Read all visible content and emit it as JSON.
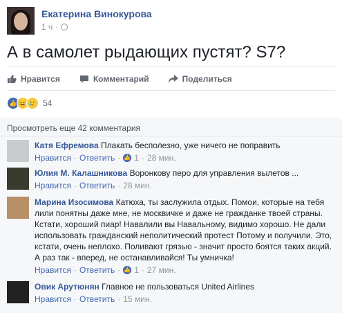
{
  "post": {
    "author": "Екатерина Винокурова",
    "time": "1 ч",
    "text": "А в самолет рыдающих пустят? S7?"
  },
  "actions": {
    "like": "Нравится",
    "comment": "Комментарий",
    "share": "Поделиться"
  },
  "reactions": {
    "count": "54"
  },
  "comments_section": {
    "more_label": "Просмотреть еще 42 комментария",
    "items": [
      {
        "name": "Катя Ефремова",
        "text": "Плакать бесполезно, уже ничего не поправить",
        "like": "Нравится",
        "reply": "Ответить",
        "likes": "1",
        "time": "28 мин."
      },
      {
        "name": "Юлия М. Калашникова",
        "text": "Воронкову перо для управления вылетов ...",
        "like": "Нравится",
        "reply": "Ответить",
        "time": "28 мин."
      },
      {
        "name": "Марина Изосимова",
        "text": "Катюха, ты заслужила отдых. Помои, которые на тебя лили понятны даже мне, не москвичке и даже не гражданке твоей страны. Кстати, хороший пиар! Навалили вы Навальному, видимо хорошо. Не дали использовать гражданский неполитический протест Потому и получили. Это, кстати, очень неплохо. Поливают грязью - значит просто боятся таких акций. А раз так - вперед, не останавливайся! Ты умничка!",
        "like": "Нравится",
        "reply": "Ответить",
        "likes": "1",
        "time": "27 мин."
      },
      {
        "name": "Овик Арутюнян",
        "text": "Главное не пользоваться United Airlines",
        "like": "Нравится",
        "reply": "Ответить",
        "time": "15 мин."
      }
    ]
  },
  "colors": {
    "link": "#365899",
    "muted": "#90949c",
    "accent": "#4267b2"
  }
}
